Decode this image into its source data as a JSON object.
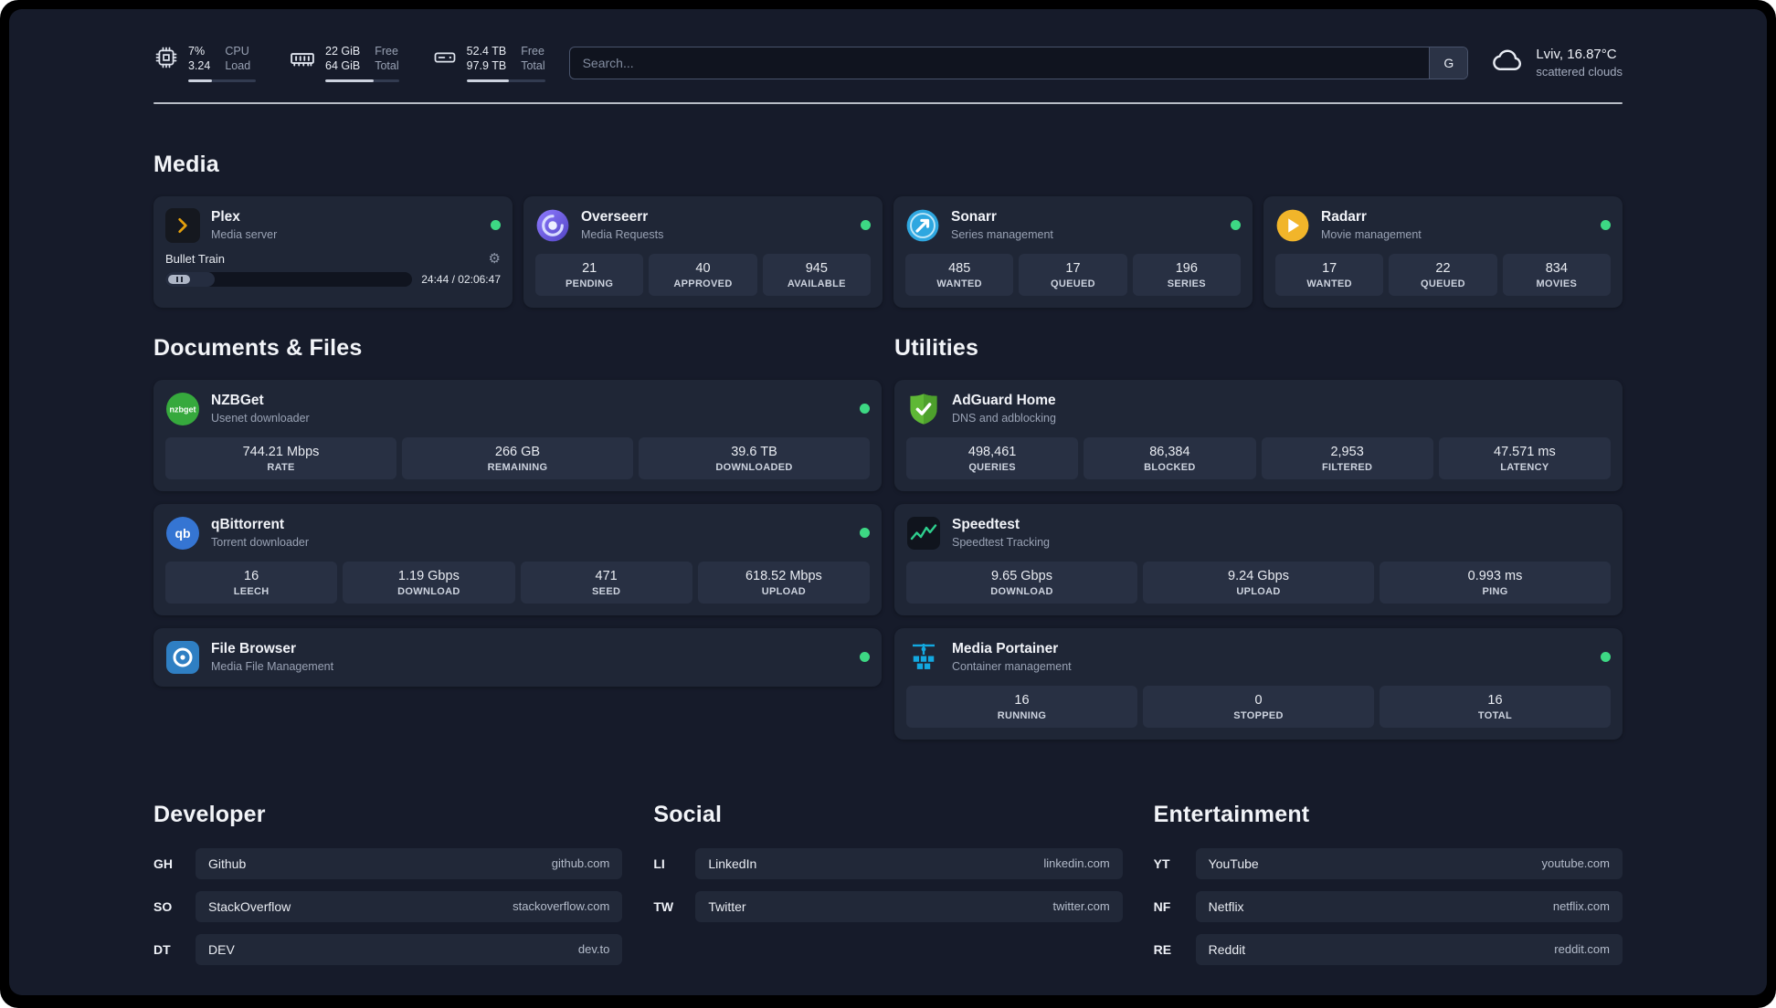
{
  "topbar": {
    "cpu": {
      "icon": "cpu-icon",
      "value_top": "7%",
      "value_bottom": "3.24",
      "label_top": "CPU",
      "label_bottom": "Load",
      "progress_percent": 35
    },
    "memory": {
      "icon": "ram-icon",
      "value_top": "22 GiB",
      "value_bottom": "64 GiB",
      "label_top": "Free",
      "label_bottom": "Total",
      "progress_percent": 66
    },
    "disk": {
      "icon": "disk-icon",
      "value_top": "52.4 TB",
      "value_bottom": "97.9 TB",
      "label_top": "Free",
      "label_bottom": "Total",
      "progress_percent": 54
    },
    "search": {
      "placeholder": "Search...",
      "button_label": "G"
    },
    "weather": {
      "icon": "cloud-icon",
      "location": "Lviv, 16.87°C",
      "condition": "scattered clouds"
    }
  },
  "media": {
    "title": "Media",
    "plex": {
      "icon": "plex-icon",
      "name": "Plex",
      "subtitle": "Media server",
      "now_playing": "Bullet Train",
      "time_display": "24:44 / 02:06:47",
      "progress_percent": 20
    },
    "overseerr": {
      "icon": "overseerr-icon",
      "name": "Overseerr",
      "subtitle": "Media Requests",
      "stats": [
        {
          "value": "21",
          "label": "PENDING"
        },
        {
          "value": "40",
          "label": "APPROVED"
        },
        {
          "value": "945",
          "label": "AVAILABLE"
        }
      ]
    },
    "sonarr": {
      "icon": "sonarr-icon",
      "name": "Sonarr",
      "subtitle": "Series management",
      "stats": [
        {
          "value": "485",
          "label": "WANTED"
        },
        {
          "value": "17",
          "label": "QUEUED"
        },
        {
          "value": "196",
          "label": "SERIES"
        }
      ]
    },
    "radarr": {
      "icon": "radarr-icon",
      "name": "Radarr",
      "subtitle": "Movie management",
      "stats": [
        {
          "value": "17",
          "label": "WANTED"
        },
        {
          "value": "22",
          "label": "QUEUED"
        },
        {
          "value": "834",
          "label": "MOVIES"
        }
      ]
    }
  },
  "documents": {
    "title": "Documents & Files",
    "nzbget": {
      "icon": "nzbget-icon",
      "name": "NZBGet",
      "subtitle": "Usenet downloader",
      "stats": [
        {
          "value": "744.21 Mbps",
          "label": "RATE"
        },
        {
          "value": "266 GB",
          "label": "REMAINING"
        },
        {
          "value": "39.6 TB",
          "label": "DOWNLOADED"
        }
      ]
    },
    "qbittorrent": {
      "icon": "qbittorrent-icon",
      "name": "qBittorrent",
      "subtitle": "Torrent downloader",
      "stats": [
        {
          "value": "16",
          "label": "LEECH"
        },
        {
          "value": "1.19 Gbps",
          "label": "DOWNLOAD"
        },
        {
          "value": "471",
          "label": "SEED"
        },
        {
          "value": "618.52 Mbps",
          "label": "UPLOAD"
        }
      ]
    },
    "filebrowser": {
      "icon": "filebrowser-icon",
      "name": "File Browser",
      "subtitle": "Media File Management"
    }
  },
  "utilities": {
    "title": "Utilities",
    "adguard": {
      "icon": "adguard-icon",
      "name": "AdGuard Home",
      "subtitle": "DNS and adblocking",
      "stats": [
        {
          "value": "498,461",
          "label": "QUERIES"
        },
        {
          "value": "86,384",
          "label": "BLOCKED"
        },
        {
          "value": "2,953",
          "label": "FILTERED"
        },
        {
          "value": "47.571 ms",
          "label": "LATENCY"
        }
      ]
    },
    "speedtest": {
      "icon": "speedtest-icon",
      "name": "Speedtest",
      "subtitle": "Speedtest Tracking",
      "stats": [
        {
          "value": "9.65 Gbps",
          "label": "DOWNLOAD"
        },
        {
          "value": "9.24 Gbps",
          "label": "UPLOAD"
        },
        {
          "value": "0.993 ms",
          "label": "PING"
        }
      ]
    },
    "portainer": {
      "icon": "portainer-icon",
      "name": "Media Portainer",
      "subtitle": "Container management",
      "stats": [
        {
          "value": "16",
          "label": "RUNNING"
        },
        {
          "value": "0",
          "label": "STOPPED"
        },
        {
          "value": "16",
          "label": "TOTAL"
        }
      ]
    }
  },
  "bookmarks": {
    "developer": {
      "title": "Developer",
      "links": [
        {
          "abbr": "GH",
          "name": "Github",
          "url": "github.com"
        },
        {
          "abbr": "SO",
          "name": "StackOverflow",
          "url": "stackoverflow.com"
        },
        {
          "abbr": "DT",
          "name": "DEV",
          "url": "dev.to"
        }
      ]
    },
    "social": {
      "title": "Social",
      "links": [
        {
          "abbr": "LI",
          "name": "LinkedIn",
          "url": "linkedin.com"
        },
        {
          "abbr": "TW",
          "name": "Twitter",
          "url": "twitter.com"
        }
      ]
    },
    "entertainment": {
      "title": "Entertainment",
      "links": [
        {
          "abbr": "YT",
          "name": "YouTube",
          "url": "youtube.com"
        },
        {
          "abbr": "NF",
          "name": "Netflix",
          "url": "netflix.com"
        },
        {
          "abbr": "RE",
          "name": "Reddit",
          "url": "reddit.com"
        }
      ]
    }
  },
  "colors": {
    "background": "#161b2a",
    "card": "#1f2636",
    "tile": "#283043",
    "status_online": "#3dd884",
    "plex": "#e5a00d",
    "overseerr": "#6c5ce7",
    "sonarr": "#2ea7e0",
    "radarr": "#f1b52a",
    "nzbget": "#36a93d",
    "qbittorrent": "#3575d3",
    "filebrowser": "#2f7fc3",
    "adguard": "#5fb836",
    "speedtest": "#2ecf8e",
    "portainer": "#13a8e0"
  }
}
